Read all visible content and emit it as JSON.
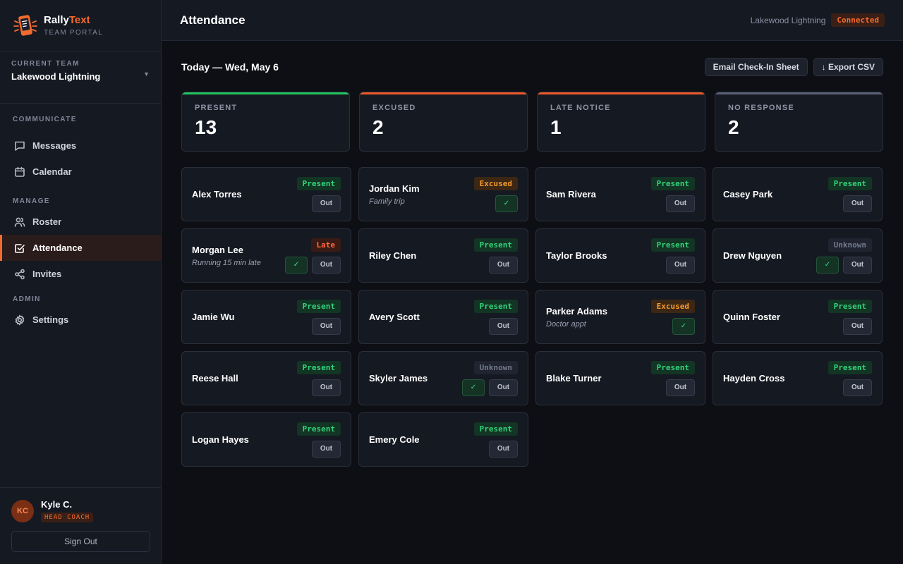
{
  "brand": {
    "name_a": "Rally",
    "name_b": "Text",
    "sub": "TEAM PORTAL"
  },
  "team_picker": {
    "label": "CURRENT TEAM",
    "team": "Lakewood Lightning"
  },
  "nav": {
    "communicate": "COMMUNICATE",
    "manage": "MANAGE",
    "admin": "ADMIN",
    "messages": "Messages",
    "calendar": "Calendar",
    "roster": "Roster",
    "attendance": "Attendance",
    "invites": "Invites",
    "settings": "Settings"
  },
  "user": {
    "initials": "KC",
    "name": "Kyle C.",
    "role": "HEAD COACH",
    "signout": "Sign Out"
  },
  "header": {
    "title": "Attendance",
    "team": "Lakewood Lightning",
    "status": "Connected"
  },
  "date_row": {
    "title": "Today — Wed, May 6",
    "email_btn": "Email Check-In Sheet",
    "export_btn": "↓ Export CSV"
  },
  "stats": [
    {
      "label": "PRESENT",
      "value": "13",
      "accent": "#22c55e"
    },
    {
      "label": "EXCUSED",
      "value": "2",
      "accent": "#ef5a2b"
    },
    {
      "label": "LATE NOTICE",
      "value": "1",
      "accent": "#ef5a2b"
    },
    {
      "label": "NO RESPONSE",
      "value": "2",
      "accent": "#586072"
    }
  ],
  "controls": {
    "out": "Out",
    "check": "✓"
  },
  "players": [
    {
      "name": "Alex Torres",
      "note": "",
      "status": "Present",
      "kind": "present",
      "check": false,
      "out": true
    },
    {
      "name": "Jordan Kim",
      "note": "Family trip",
      "status": "Excused",
      "kind": "excused",
      "check": true,
      "out": false
    },
    {
      "name": "Sam Rivera",
      "note": "",
      "status": "Present",
      "kind": "present",
      "check": false,
      "out": true
    },
    {
      "name": "Casey Park",
      "note": "",
      "status": "Present",
      "kind": "present",
      "check": false,
      "out": true
    },
    {
      "name": "Morgan Lee",
      "note": "Running 15 min late",
      "status": "Late",
      "kind": "late",
      "check": true,
      "out": true
    },
    {
      "name": "Riley Chen",
      "note": "",
      "status": "Present",
      "kind": "present",
      "check": false,
      "out": true
    },
    {
      "name": "Taylor Brooks",
      "note": "",
      "status": "Present",
      "kind": "present",
      "check": false,
      "out": true
    },
    {
      "name": "Drew Nguyen",
      "note": "",
      "status": "Unknown",
      "kind": "unknown",
      "check": true,
      "out": true
    },
    {
      "name": "Jamie Wu",
      "note": "",
      "status": "Present",
      "kind": "present",
      "check": false,
      "out": true
    },
    {
      "name": "Avery Scott",
      "note": "",
      "status": "Present",
      "kind": "present",
      "check": false,
      "out": true
    },
    {
      "name": "Parker Adams",
      "note": "Doctor appt",
      "status": "Excused",
      "kind": "excused",
      "check": true,
      "out": false
    },
    {
      "name": "Quinn Foster",
      "note": "",
      "status": "Present",
      "kind": "present",
      "check": false,
      "out": true
    },
    {
      "name": "Reese Hall",
      "note": "",
      "status": "Present",
      "kind": "present",
      "check": false,
      "out": true
    },
    {
      "name": "Skyler James",
      "note": "",
      "status": "Unknown",
      "kind": "unknown",
      "check": true,
      "out": true
    },
    {
      "name": "Blake Turner",
      "note": "",
      "status": "Present",
      "kind": "present",
      "check": false,
      "out": true
    },
    {
      "name": "Hayden Cross",
      "note": "",
      "status": "Present",
      "kind": "present",
      "check": false,
      "out": true
    },
    {
      "name": "Logan Hayes",
      "note": "",
      "status": "Present",
      "kind": "present",
      "check": false,
      "out": true
    },
    {
      "name": "Emery Cole",
      "note": "",
      "status": "Present",
      "kind": "present",
      "check": false,
      "out": true
    }
  ],
  "icons": {
    "logo": "phone-logo-icon",
    "messages": "chat-icon",
    "calendar": "calendar-icon",
    "roster": "users-icon",
    "attendance": "check-square-icon",
    "invites": "share-icon",
    "settings": "gear-icon"
  },
  "colors": {
    "accent": "#f26b2e",
    "present": "#34d27a",
    "excused": "#f59a2e",
    "late": "#ff6a3d",
    "unknown": "#737b8c"
  }
}
